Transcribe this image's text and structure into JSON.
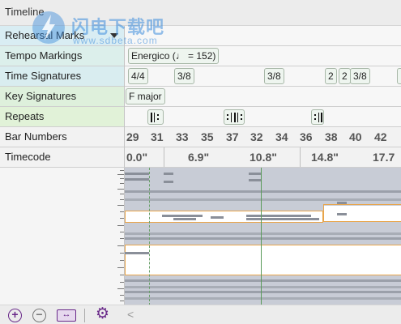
{
  "window": {
    "title": "Timeline"
  },
  "watermark": {
    "text": "闪电下载吧",
    "url": "www.sdbeta.com"
  },
  "lanes": {
    "rehearsal": {
      "label": "Rehearsal Marks"
    },
    "tempo": {
      "label": "Tempo Markings",
      "items": [
        "Energico (♩ = 152)"
      ]
    },
    "timesig": {
      "label": "Time Signatures",
      "items": [
        "4/4",
        "3/8",
        "3/8",
        "2",
        "2",
        "3/8"
      ]
    },
    "keysig": {
      "label": "Key Signatures",
      "items": [
        "F major"
      ]
    },
    "repeats": {
      "label": "Repeats"
    },
    "bars": {
      "label": "Bar Numbers",
      "numbers": [
        "29",
        "31",
        "33",
        "35",
        "37",
        "32",
        "34",
        "36",
        "38",
        "40",
        "42"
      ]
    },
    "timecode": {
      "label": "Timecode",
      "values": [
        "0.0\"",
        "6.9\"",
        "10.8\"",
        "14.8\"",
        "17.7"
      ]
    }
  },
  "footer": {
    "zoom_in": "+",
    "zoom_out": "−",
    "fit": "↔",
    "settings": "⚙",
    "scroll": "<"
  },
  "colors": {
    "accent": "#6a2a8a",
    "overview_bg": "#c8ccd6",
    "highlight": "#e8a54b",
    "playhead": "#5a9a5a"
  }
}
